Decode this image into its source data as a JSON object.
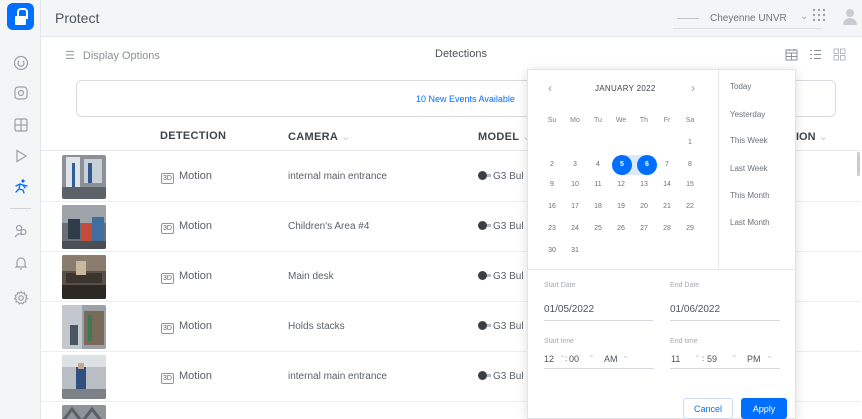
{
  "app": {
    "title": "Protect"
  },
  "console": {
    "name": "Cheyenne UNVR"
  },
  "toolbar": {
    "display_options": "Display Options",
    "title": "Detections"
  },
  "banner": {
    "text": "10 New Events Available"
  },
  "table": {
    "headers": {
      "detection": "DETECTION",
      "camera": "CAMERA",
      "model": "MODEL",
      "partial": "ION"
    },
    "rows": [
      {
        "detection": "Motion",
        "camera": "internal main entrance",
        "model": "G3 Bul"
      },
      {
        "detection": "Motion",
        "camera": "Children's Area #4",
        "model": "G3 Bul"
      },
      {
        "detection": "Motion",
        "camera": "Main desk",
        "model": "G3 Bul"
      },
      {
        "detection": "Motion",
        "camera": "Holds stacks",
        "model": "G3 Bul"
      },
      {
        "detection": "Motion",
        "camera": "internal main entrance",
        "model": "G3 Bul"
      }
    ]
  },
  "calendar": {
    "month": "JANUARY 2022",
    "weekdays": [
      "Su",
      "Mo",
      "Tu",
      "We",
      "Th",
      "Fr",
      "Sa"
    ],
    "selected_start": "5",
    "selected_end": "6",
    "days": [
      "1",
      "2",
      "3",
      "4",
      "5",
      "6",
      "7",
      "8",
      "9",
      "10",
      "11",
      "12",
      "13",
      "14",
      "15",
      "16",
      "17",
      "18",
      "19",
      "20",
      "21",
      "22",
      "23",
      "24",
      "25",
      "26",
      "27",
      "28",
      "29",
      "30",
      "31"
    ]
  },
  "quick_ranges": [
    "Today",
    "Yesterday",
    "This Week",
    "Last Week",
    "This Month",
    "Last Month"
  ],
  "range": {
    "start_date_label": "Start Date",
    "start_date": "01/05/2022",
    "end_date_label": "End Date",
    "end_date": "01/06/2022",
    "start_time_label": "Start time",
    "start_hour": "12",
    "start_minute": "00",
    "start_period": "AM",
    "end_time_label": "End time",
    "end_hour": "11",
    "end_minute": "59",
    "end_period": "PM"
  },
  "buttons": {
    "cancel": "Cancel",
    "apply": "Apply"
  },
  "colors": {
    "accent": "#006fff",
    "range_fill": "#dbe8fb"
  }
}
